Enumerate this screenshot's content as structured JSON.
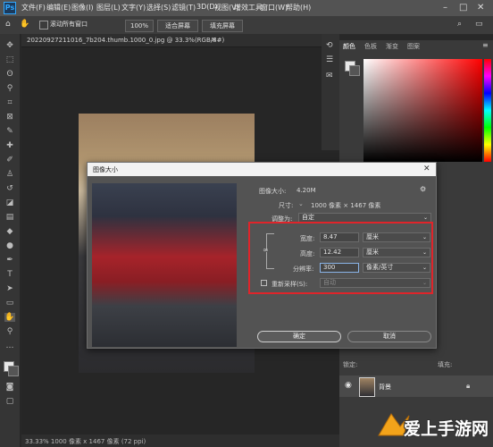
{
  "app": {
    "logo": "Ps"
  },
  "menubar": {
    "items": [
      "文件(F)",
      "编辑(E)",
      "图像(I)",
      "图层(L)",
      "文字(Y)",
      "选择(S)",
      "滤镜(T)",
      "3D(D)",
      "视图(V)",
      "增效工具",
      "窗口(W)",
      "帮助(H)"
    ]
  },
  "options": {
    "scroll_all": "滚动所有窗口",
    "zoom": "100%",
    "fit_screen": "适合屏幕",
    "fill_screen": "填充屏幕"
  },
  "document": {
    "tab_title": "20220927211016_7b204.thumb.1000_0.jpg @ 33.3%(RGB/8#)",
    "status": "33.33%   1000 像素 x 1467 像素 (72 ppi)"
  },
  "panels": {
    "tabs": [
      "颜色",
      "色板",
      "渐变",
      "图案"
    ]
  },
  "layers": {
    "layer_name": "背景",
    "lock_label": "锁定:",
    "fill_label": "填充:"
  },
  "dialog": {
    "title": "图像大小",
    "image_size_label": "图像大小:",
    "image_size_value": "4.20M",
    "dimensions_label": "尺寸:",
    "dimensions_value": "1000 像素 × 1467 像素",
    "fit_label": "调整为:",
    "fit_value": "自定",
    "width_label": "宽度:",
    "width_value": "8.47",
    "width_unit": "厘米",
    "height_label": "高度:",
    "height_value": "12.42",
    "height_unit": "厘米",
    "resolution_label": "分辨率:",
    "resolution_value": "300",
    "resolution_unit": "像素/英寸",
    "resample_label": "重新采样(S):",
    "resample_value": "自动",
    "ok": "确定",
    "cancel": "取消"
  },
  "watermark": {
    "text": "爱上手游网"
  },
  "colors": {
    "highlight": "#e0242a",
    "accent": "#31a8ff"
  }
}
